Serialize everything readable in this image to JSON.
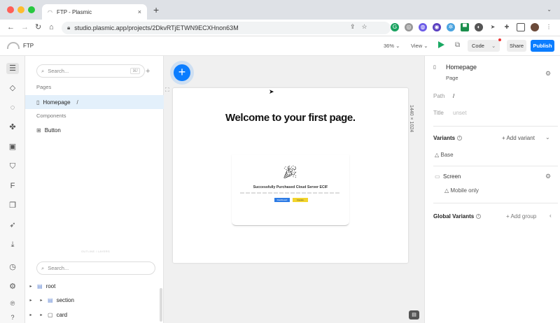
{
  "browser": {
    "tab_title": "FTP - Plasmic",
    "tab_close": "×",
    "new_tab": "+",
    "url": "studio.plasmic.app/projects/2DkvRTjETWN9ECXHnon63M",
    "colors": {
      "red": "#ff5f57",
      "yellow": "#febc2e",
      "green": "#28c840"
    }
  },
  "topbar": {
    "project_name": "FTP",
    "zoom": "36%",
    "view": "View",
    "code": "Code",
    "share": "Share",
    "publish": "Publish",
    "accent": "#0b7dff"
  },
  "left_panel": {
    "search_placeholder": "Search...",
    "search_shortcut": "⌘/",
    "pages_title": "Pages",
    "pages": [
      {
        "name": "Homepage",
        "path": "/"
      }
    ],
    "components_title": "Components",
    "components": [
      {
        "name": "Button"
      }
    ],
    "outline_divider": "OUTLINE / LAYERS",
    "tree_search_placeholder": "Search...",
    "tree": [
      {
        "name": "root"
      },
      {
        "name": "section"
      },
      {
        "name": "card"
      }
    ]
  },
  "canvas": {
    "heading": "Welcome to your first page.",
    "card_title": "Successfully Purchased Cloud Server ECIF",
    "card_btn_primary": "Dashboard",
    "card_btn_secondary": "Invoice",
    "artboard_size": "1440 × 1024"
  },
  "right_panel": {
    "page_name": "Homepage",
    "page_type": "Page",
    "path_label": "Path",
    "path_value": "/",
    "title_label": "Title",
    "title_placeholder": "unset",
    "variants_label": "Variants",
    "add_variant": "+ Add variant",
    "base_variant": "Base",
    "screen_label": "Screen",
    "mobile_only": "Mobile only",
    "global_variants_label": "Global Variants",
    "add_group": "+ Add group"
  }
}
